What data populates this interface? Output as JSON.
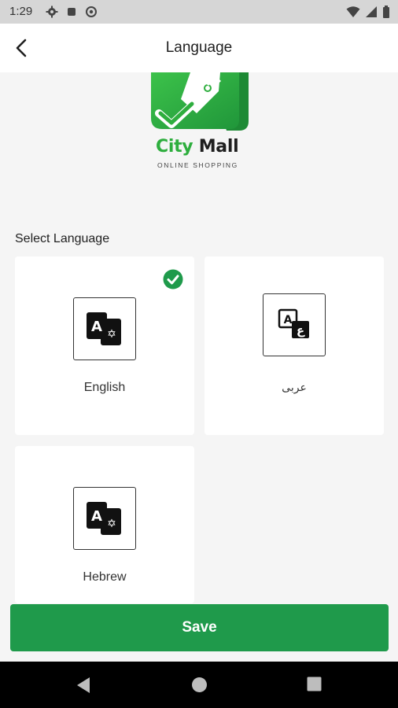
{
  "status_bar": {
    "time": "1:29",
    "icons_left": [
      "gear-icon",
      "square-notification-icon",
      "at-sync-icon"
    ],
    "icons_right": [
      "wifi-icon",
      "cellular-signal-icon",
      "battery-icon"
    ]
  },
  "app_bar": {
    "title": "Language",
    "back_icon": "back-arrow-icon"
  },
  "logo": {
    "brand_part1": "City",
    "brand_part2": "Mall",
    "tagline": "ONLINE SHOPPING",
    "colors": {
      "green": "#2eae3e",
      "dark_green": "#1e8a35"
    }
  },
  "section_label": "Select Language",
  "languages": [
    {
      "label": "English",
      "selected": true,
      "icon": "translate-a-star-icon"
    },
    {
      "label": "عربى",
      "selected": false,
      "icon": "translate-a-arabic-icon"
    },
    {
      "label": "Hebrew",
      "selected": false,
      "icon": "translate-a-star-icon"
    }
  ],
  "save_label": "Save",
  "colors": {
    "accent": "#1f9a4b",
    "check": "#1f9a4b",
    "background": "#f5f5f5"
  },
  "nav_bar": {
    "buttons": [
      "back-triangle-icon",
      "home-circle-icon",
      "recents-square-icon"
    ]
  }
}
